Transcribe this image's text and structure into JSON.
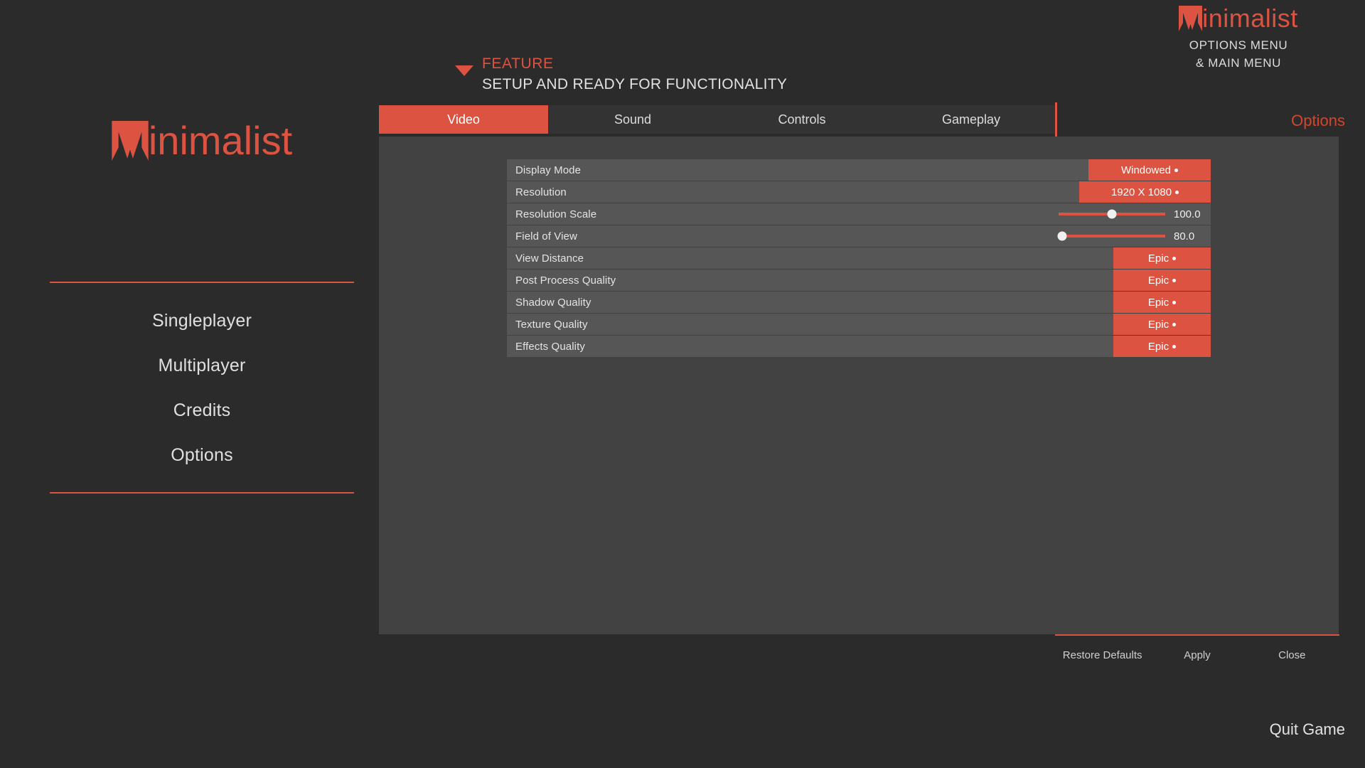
{
  "theme": {
    "accent": "#dd5341",
    "page_bg": "#2b2b2b",
    "panel_bg": "#424242",
    "row_bg": "#565656",
    "tabbar_bg": "#333333",
    "text": "#e0e0e0"
  },
  "brand": {
    "logo_text": "inimalist",
    "logo_mark": "m-triangle-logo",
    "subtitle_line1": "OPTIONS MENU",
    "subtitle_line2": "& MAIN MENU"
  },
  "feature": {
    "caret_icon": "triangle-down-icon",
    "title": "FEATURE",
    "subtitle": "SETUP AND READY FOR FUNCTIONALITY"
  },
  "main_menu": {
    "logo_text": "inimalist",
    "items": [
      {
        "label": "Singleplayer"
      },
      {
        "label": "Multiplayer"
      },
      {
        "label": "Credits"
      },
      {
        "label": "Options"
      }
    ]
  },
  "options": {
    "screen_label": "Options",
    "tabs": [
      {
        "label": "Video",
        "active": true
      },
      {
        "label": "Sound",
        "active": false
      },
      {
        "label": "Controls",
        "active": false
      },
      {
        "label": "Gameplay",
        "active": false
      }
    ],
    "settings": [
      {
        "label": "Display Mode",
        "type": "dropdown",
        "value": "Windowed",
        "width_class": "dd-w-wide"
      },
      {
        "label": "Resolution",
        "type": "dropdown",
        "value": "1920 X 1080",
        "width_class": "dd-w-res"
      },
      {
        "label": "Resolution Scale",
        "type": "slider",
        "value": "100.0",
        "handle_pct": 50
      },
      {
        "label": "Field of View",
        "type": "slider",
        "value": "80.0",
        "handle_pct": 3
      },
      {
        "label": "View Distance",
        "type": "dropdown",
        "value": "Epic",
        "width_class": "dd-w-qual"
      },
      {
        "label": "Post Process Quality",
        "type": "dropdown",
        "value": "Epic",
        "width_class": "dd-w-qual"
      },
      {
        "label": "Shadow Quality",
        "type": "dropdown",
        "value": "Epic",
        "width_class": "dd-w-qual"
      },
      {
        "label": "Texture Quality",
        "type": "dropdown",
        "value": "Epic",
        "width_class": "dd-w-qual"
      },
      {
        "label": "Effects Quality",
        "type": "dropdown",
        "value": "Epic",
        "width_class": "dd-w-qual"
      }
    ],
    "actions": [
      {
        "label": "Restore Defaults"
      },
      {
        "label": "Apply"
      },
      {
        "label": "Close"
      }
    ]
  },
  "quit": {
    "label": "Quit Game"
  }
}
